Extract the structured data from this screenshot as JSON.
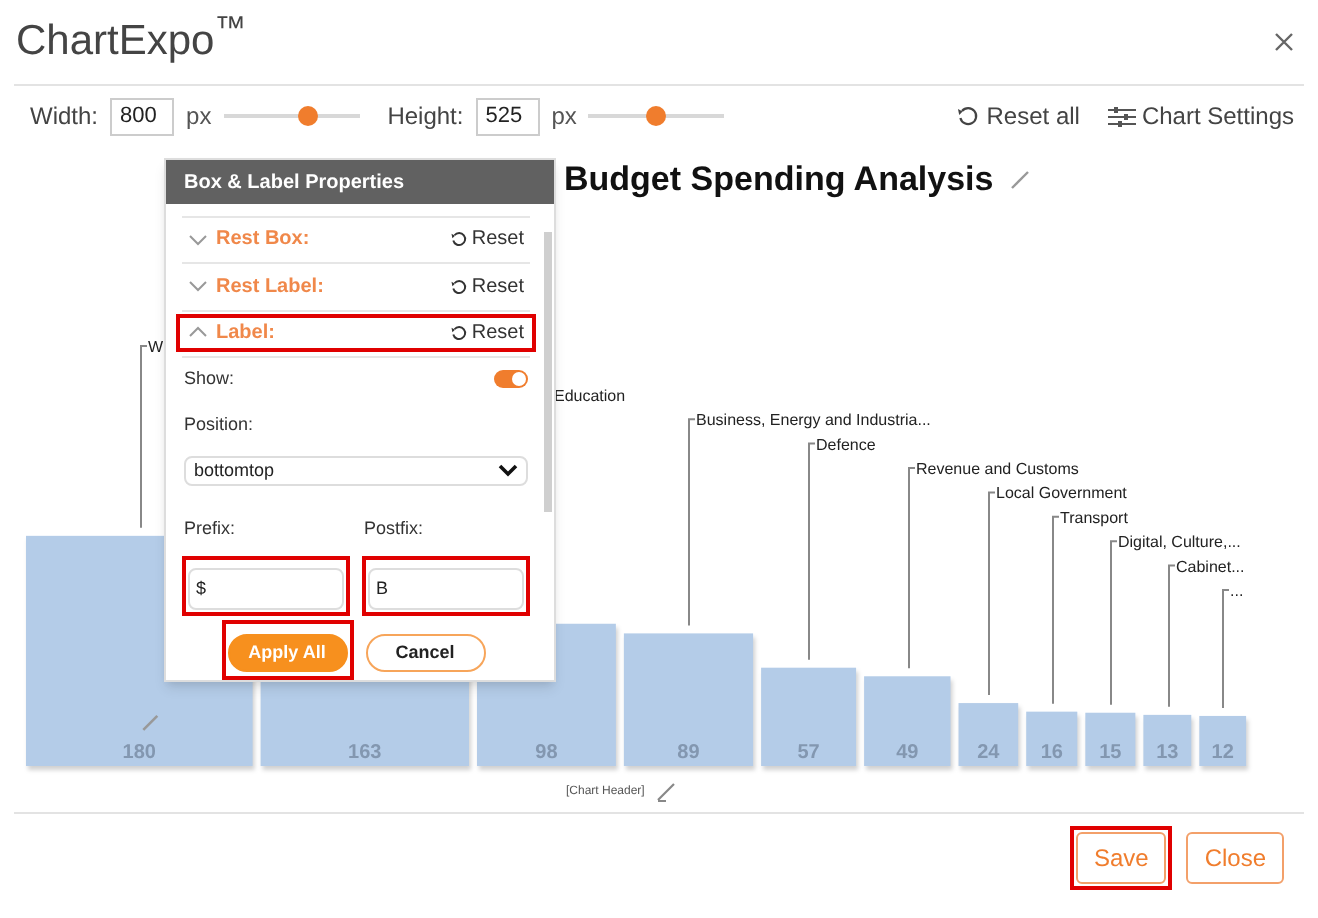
{
  "app": {
    "title": "ChartExpo$^{™}$"
  },
  "toolbar": {
    "width": {
      "label": "Width:",
      "value": "800",
      "unit": "px",
      "level": 0.62
    },
    "height": {
      "label": "Height:",
      "value": "525",
      "unit": "px",
      "level": 0.49
    },
    "reset_all": "Reset all",
    "chart_settings": "Chart Settings"
  },
  "chart": {
    "title": "Budget Spending Analysis",
    "header_placeholder": "[Chart Header]",
    "bars": [
      {
        "label": "W",
        "value": "180"
      },
      {
        "value": "163"
      },
      {
        "label": "Education",
        "value": "98"
      },
      {
        "label": "Business, Energy and Industria...",
        "value": "89"
      },
      {
        "label": "Defence",
        "value": "57"
      },
      {
        "label": "Revenue and Customs",
        "value": "49"
      },
      {
        "label": "Local Government",
        "value": "24"
      },
      {
        "label": "Transport",
        "value": "16"
      },
      {
        "label": "Digital, Culture,...",
        "value": "15"
      },
      {
        "label": "Cabinet...",
        "value": "13"
      },
      {
        "label": "...",
        "value": "12"
      }
    ]
  },
  "panel": {
    "title": "Box & Label Properties",
    "sections": [
      {
        "label": "Rest Box:",
        "expanded": false,
        "highlighted": false,
        "reset": "Reset"
      },
      {
        "label": "Rest Label:",
        "expanded": false,
        "highlighted": false,
        "reset": "Reset"
      },
      {
        "label": "Label:",
        "expanded": true,
        "highlighted": true,
        "reset": "Reset"
      }
    ],
    "show": {
      "label": "Show:",
      "on": true
    },
    "position": {
      "label": "Position:",
      "value": "bottomtop"
    },
    "prefix": {
      "label": "Prefix:",
      "value": "$",
      "highlighted": true
    },
    "postfix": {
      "label": "Postfix:",
      "value": "B",
      "highlighted": true
    },
    "buttons": [
      {
        "label": "Apply All",
        "kind": "primary",
        "highlighted": true
      },
      {
        "label": "Cancel",
        "kind": "secondary",
        "highlighted": false
      }
    ]
  },
  "footer": {
    "buttons": [
      {
        "label": "Save",
        "highlighted": true
      },
      {
        "label": "Close",
        "highlighted": false
      }
    ]
  }
}
